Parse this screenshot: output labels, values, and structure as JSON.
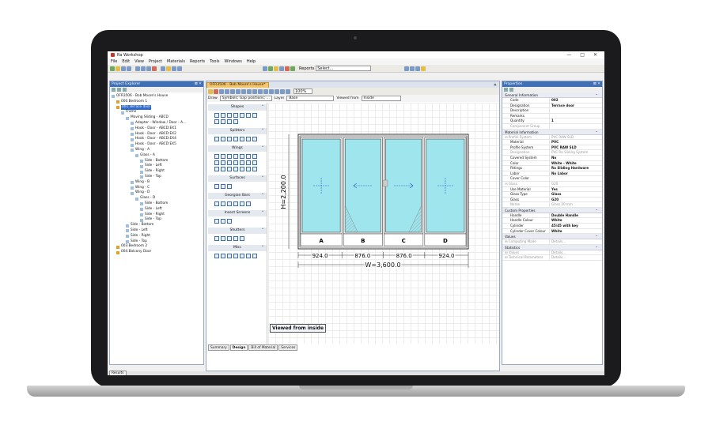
{
  "window": {
    "title": "Ra Workshop",
    "min": "—",
    "max": "□",
    "close": "✕"
  },
  "menu": [
    "File",
    "Edit",
    "View",
    "Project",
    "Materials",
    "Reports",
    "Tools",
    "Windows",
    "Help"
  ],
  "toolbar": {
    "reports_label": "Reports",
    "reports_value": "Select..."
  },
  "explorer": {
    "title": "Project Explorer",
    "close": "⊠ ✕",
    "tree": [
      {
        "d": 0,
        "t": "OFR3506 - Bob Moore's House",
        "w": true
      },
      {
        "d": 1,
        "t": "000.Bedroom 1"
      },
      {
        "d": 1,
        "t": "001.Terrace door",
        "sel": true
      },
      {
        "d": 2,
        "t": "Frame",
        "w": true
      },
      {
        "d": 3,
        "t": "Moving Sliding - ABCD",
        "w": true
      },
      {
        "d": 4,
        "t": "Adapter - Window / Door - A...",
        "w": true
      },
      {
        "d": 4,
        "t": "Hook - Door - ABCD:EX1",
        "w": true
      },
      {
        "d": 4,
        "t": "Hook - Door - ABCD:EX2",
        "w": true
      },
      {
        "d": 4,
        "t": "Hook - Door - ABCD:EX4",
        "w": true
      },
      {
        "d": 4,
        "t": "Hook - Door - ABCD:EX5",
        "w": true
      },
      {
        "d": 4,
        "t": "Wing - A",
        "w": true
      },
      {
        "d": 5,
        "t": "Glass - A",
        "w": true
      },
      {
        "d": 6,
        "t": "Side - Bottom",
        "w": true
      },
      {
        "d": 6,
        "t": "Side - Left",
        "w": true
      },
      {
        "d": 6,
        "t": "Side - Right",
        "w": true
      },
      {
        "d": 6,
        "t": "Side - Top",
        "w": true
      },
      {
        "d": 4,
        "t": "Wing - B",
        "w": true
      },
      {
        "d": 4,
        "t": "Wing - C",
        "w": true
      },
      {
        "d": 4,
        "t": "Wing - D",
        "w": true
      },
      {
        "d": 5,
        "t": "Glass - D",
        "w": true
      },
      {
        "d": 6,
        "t": "Side - Bottom",
        "w": true
      },
      {
        "d": 6,
        "t": "Side - Left",
        "w": true
      },
      {
        "d": 6,
        "t": "Side - Right",
        "w": true
      },
      {
        "d": 6,
        "t": "Side - Top",
        "w": true
      },
      {
        "d": 3,
        "t": "Side - Bottom",
        "w": true
      },
      {
        "d": 3,
        "t": "Side - Left",
        "w": true
      },
      {
        "d": 3,
        "t": "Side - Right",
        "w": true
      },
      {
        "d": 3,
        "t": "Side - Top",
        "w": true
      },
      {
        "d": 1,
        "t": "003.Bedroom 2"
      },
      {
        "d": 1,
        "t": "004.Balcony Door"
      }
    ]
  },
  "document": {
    "tab": "OFR3506 - Bob Moore's House*",
    "close": "✕",
    "zoom": "100%",
    "draw_label": "Draw",
    "draw_value": "Symbols; Gap positions; ...",
    "layer_label": "Layer",
    "layer_value": "Base",
    "viewed_label": "Viewed from",
    "viewed_value": "Inside",
    "palette": [
      {
        "name": "Shapes",
        "n": 11
      },
      {
        "name": "Splitters",
        "n": 7
      },
      {
        "name": "Wings",
        "n": 21
      },
      {
        "name": "Surfaces",
        "n": 3
      },
      {
        "name": "Georgian Bars",
        "n": 6
      },
      {
        "name": "Insect Screens",
        "n": 3
      },
      {
        "name": "Shutters",
        "n": 5
      },
      {
        "name": "Misc",
        "n": 7
      }
    ],
    "collapse": "⌃",
    "drawing": {
      "height_label": "H=2,200.0",
      "width_label": "W=3,600.0",
      "segments": [
        "924.0",
        "876.0",
        "876.0",
        "924.0"
      ],
      "panels": [
        "A",
        "B",
        "C",
        "D"
      ]
    },
    "viewed_caption": "Viewed from inside",
    "bottom_tabs": [
      "Summary",
      "Design",
      "Bill of Material",
      "Services"
    ]
  },
  "properties": {
    "title": "Properties",
    "close": "⊠ ✕",
    "sections": [
      {
        "name": "General Information",
        "rows": [
          [
            "Code",
            "002"
          ],
          [
            "Designation",
            "Terrace door"
          ],
          [
            "Description",
            ""
          ],
          [
            "Remarks",
            ""
          ],
          [
            "Quantity",
            "1"
          ],
          [
            "Component Group",
            "",
            true
          ]
        ]
      },
      {
        "name": "Material Information",
        "rows": [
          [
            "⊟ Profile System",
            "PVC RAW SLD",
            true,
            true
          ],
          [
            "Material",
            "PVC"
          ],
          [
            "Profile System",
            "PVC RAW SLD"
          ],
          [
            "Designation",
            "PVC Ra Sliding System",
            true
          ],
          [
            "Covered System",
            "No"
          ],
          [
            "Color",
            "White - White"
          ],
          [
            "Fittings",
            "Ra Sliding Hardware"
          ],
          [
            "Labor",
            "No Labor"
          ],
          [
            "Cover Color",
            ""
          ],
          [
            "⊟ Glass",
            "G20",
            true,
            true
          ],
          [
            "Use Material",
            "Yes"
          ],
          [
            "Glass Type",
            "Glass"
          ],
          [
            "Glass",
            "G20"
          ],
          [
            "Name",
            "Glass 20 mm",
            true
          ]
        ]
      },
      {
        "name": "Custom Properties",
        "rows": [
          [
            "Handle",
            "Double Handle"
          ],
          [
            "Handle Colour",
            "White"
          ],
          [
            "Cylinder",
            "45/45 with key"
          ],
          [
            "Cylinder Cover Colour",
            "White"
          ]
        ]
      },
      {
        "name": "Values",
        "rows": [
          [
            "⊞ Computing Mode",
            "Details...",
            true,
            true
          ]
        ]
      },
      {
        "name": "Statistics",
        "rows": [
          [
            "⊞ Values",
            "Details...",
            true,
            true
          ],
          [
            "⊞ Technical Parameters",
            "Details...",
            true,
            true
          ]
        ]
      }
    ]
  },
  "status": {
    "results": "Results"
  }
}
